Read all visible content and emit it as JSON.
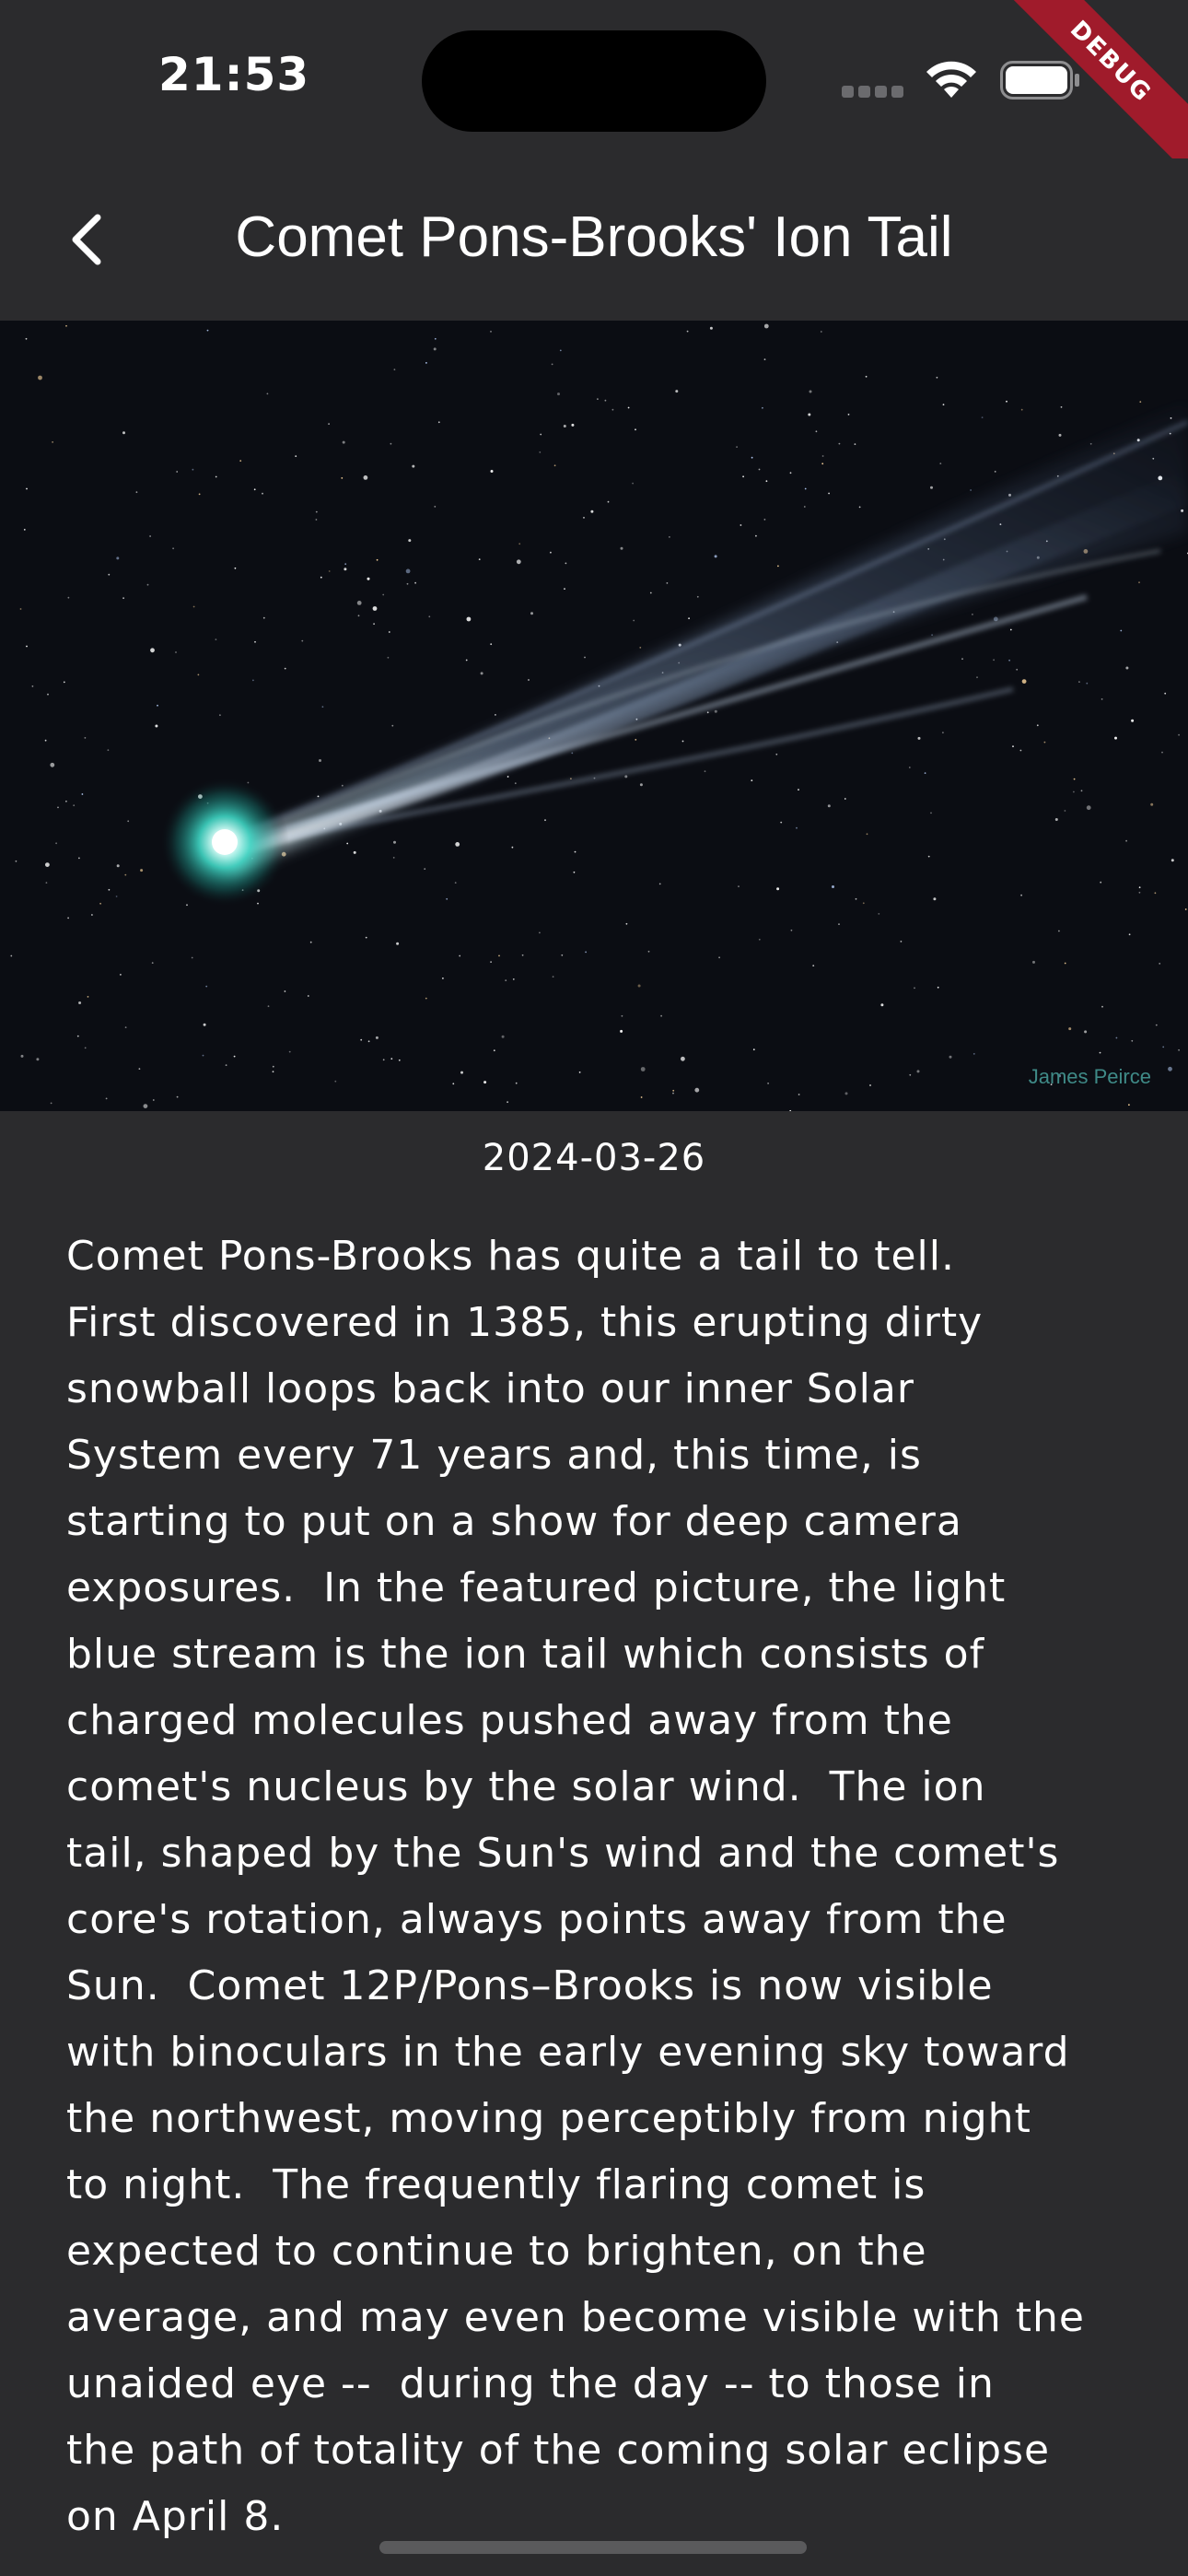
{
  "status_bar": {
    "time": "21:53",
    "icons": [
      "cellular-signal-icon",
      "wifi-icon",
      "battery-icon"
    ],
    "debug_banner": "DEBUG"
  },
  "app_bar": {
    "back_icon": "chevron-left-icon",
    "title": "Comet Pons-Brooks' Ion Tail"
  },
  "image": {
    "alt": "Comet Pons-Brooks with a long blue ion tail against a star field",
    "credit": "James Peirce"
  },
  "date": "2024-03-26",
  "explanation": "Comet Pons-Brooks has quite a tail to tell.\nFirst discovered in 1385, this erupting dirty\nsnowball loops back into our inner Solar\nSystem every 71 years and, this time, is\nstarting to put on a show for deep camera\nexposures.  In the featured picture, the light\nblue stream is the ion tail which consists of\ncharged molecules pushed away from the\ncomet's nucleus by the solar wind.  The ion\ntail, shaped by the Sun's wind and the comet's\ncore's rotation, always points away from the\nSun.  Comet 12P/Pons–Brooks is now visible\nwith binoculars in the early evening sky toward\nthe northwest, moving perceptibly from night\nto night.  The frequently flaring comet is\nexpected to continue to brighten, on the\naverage, and may even become visible with the\nunaided eye --  during the day -- to those in\nthe path of totality of the coming solar eclipse\non April 8.",
  "colors": {
    "background": "#2b2b2d",
    "debug_ribbon": "#a01b2b",
    "comet_nucleus": "#3fd6c4",
    "ion_tail": "#9bb6d8"
  }
}
